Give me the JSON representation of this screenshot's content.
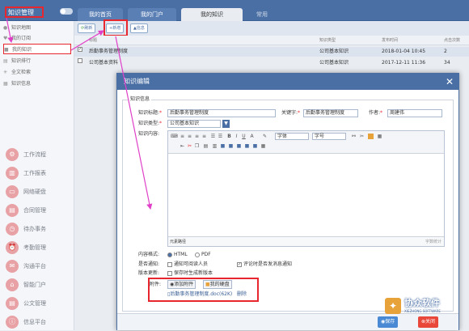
{
  "header": {
    "title": "知识管理",
    "tabs": [
      "我的首页",
      "我的门户",
      "我的知识",
      "常用"
    ]
  },
  "sidebar": {
    "items": [
      "知识地图",
      "我的订阅",
      "我的知识",
      "知识排行",
      "全文检索",
      "知识信息"
    ],
    "modules": [
      "工作流程",
      "工作报表",
      "网络硬盘",
      "合同管理",
      "待办事务",
      "考勤管理",
      "沟通平台",
      "智能门户",
      "公文管理",
      "信息平台"
    ]
  },
  "toolbar": {
    "refresh": "刷新",
    "add": "新增",
    "info": "信息"
  },
  "list": {
    "headers": [
      "标题",
      "知识类型",
      "发布时间",
      "点击次数"
    ],
    "rows": [
      {
        "title": "后勤事务管理制度",
        "type": "公司基本知识",
        "time": "2018-01-04 10:45",
        "count": "2"
      },
      {
        "title": "公司基本资料",
        "type": "公司基本知识",
        "time": "2017-12-11 11:36",
        "count": "34"
      }
    ]
  },
  "dialog": {
    "title": "知识编辑",
    "section": "知识信息",
    "fields": {
      "title_label": "知识标题:",
      "title_value": "后勤事务管理制度",
      "keyword_label": "关键字:",
      "keyword_value": "后勤事务管理制度",
      "author_label": "作者:",
      "author_value": "周建伟",
      "type_label": "知识类型:",
      "type_value": "公司基本知识",
      "content_label": "知识内容:"
    },
    "editor": {
      "font": "字体",
      "size": "字号",
      "status": "元素路径",
      "wordcount": "字数统计"
    },
    "format": {
      "label": "内容格式:",
      "html": "HTML",
      "pdf": "PDF"
    },
    "notify": {
      "label": "是否通知:",
      "option": "通知可阅读人员",
      "comment": "评论时是否发消息通知"
    },
    "version": {
      "label": "版本更新:",
      "option": "保存时生成新版本"
    },
    "attach": {
      "label": "附件:",
      "add": "添加附件",
      "disk": "我的硬盘",
      "file": "后勤事务管理制度.doc(62K)",
      "delete": "删除"
    },
    "buttons": {
      "save": "保存",
      "close": "关闭"
    }
  },
  "logo": {
    "cn": "协众软件",
    "en": "XIEZHONG SOFTWARE"
  },
  "colors": {
    "header": "#4a6fa5",
    "highlight": "#e8262e",
    "arrow": "#e040c8"
  }
}
